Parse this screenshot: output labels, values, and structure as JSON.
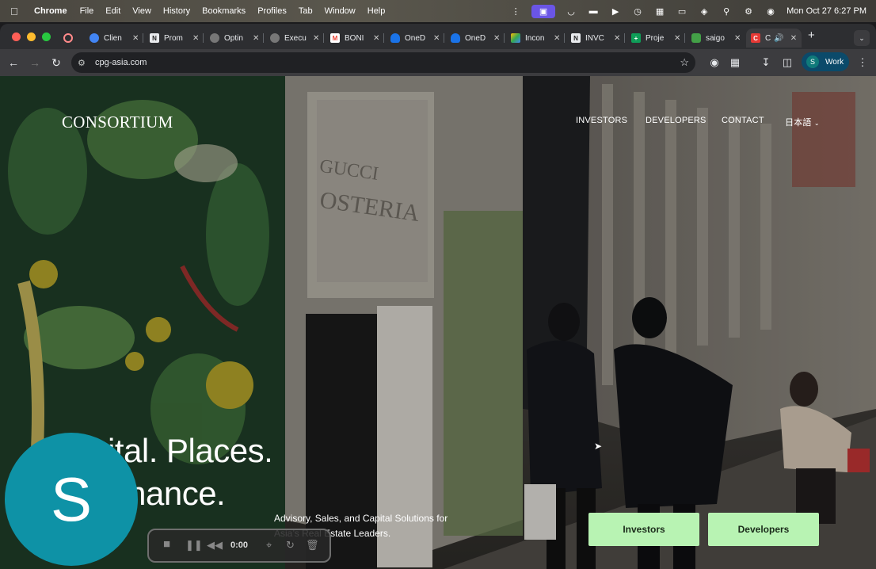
{
  "menubar": {
    "app_name": "Chrome",
    "items": [
      "File",
      "Edit",
      "View",
      "History",
      "Bookmarks",
      "Profiles",
      "Tab",
      "Window",
      "Help"
    ],
    "clock": "Mon Oct 27  6:27 PM"
  },
  "tabs": [
    {
      "label": "Clien",
      "color": "#4285f4"
    },
    {
      "label": "Prom",
      "color": "#444444"
    },
    {
      "label": "Optin",
      "color": "#666666"
    },
    {
      "label": "Execu",
      "color": "#666666"
    },
    {
      "label": "BONI",
      "color": "#ea4335"
    },
    {
      "label": "OneD",
      "color": "#1a73e8"
    },
    {
      "label": "OneD",
      "color": "#1a73e8"
    },
    {
      "label": "Incon",
      "color": "#34a853"
    },
    {
      "label": "INVC",
      "color": "#555555"
    },
    {
      "label": "Proje",
      "color": "#0f9d58"
    },
    {
      "label": "saigo",
      "color": "#2e7d32"
    },
    {
      "label": "C",
      "color": "#e53935"
    }
  ],
  "toolbar": {
    "url": "cpg-asia.com",
    "profile_initial": "S",
    "profile_label": "Work"
  },
  "site": {
    "logo": "CONSORTIUM",
    "nav": [
      "INVESTORS",
      "DEVELOPERS",
      "CONTACT",
      "日本語"
    ],
    "hero_line1": "ital. Places.",
    "hero_line2": "rmance.",
    "subtitle_line1": "Advisory, Sales, and Capital Solutions for",
    "subtitle_line2": "Asia’s Real Estate Leaders.",
    "cta_investors": "Investors",
    "cta_developers": "Developers"
  },
  "recorder": {
    "avatar_initial": "S",
    "time": "0:00"
  },
  "colors": {
    "cta_bg": "#b8f3b3",
    "avatar_bg": "#0e92a6",
    "profile_bg": "#0b4a6a"
  }
}
